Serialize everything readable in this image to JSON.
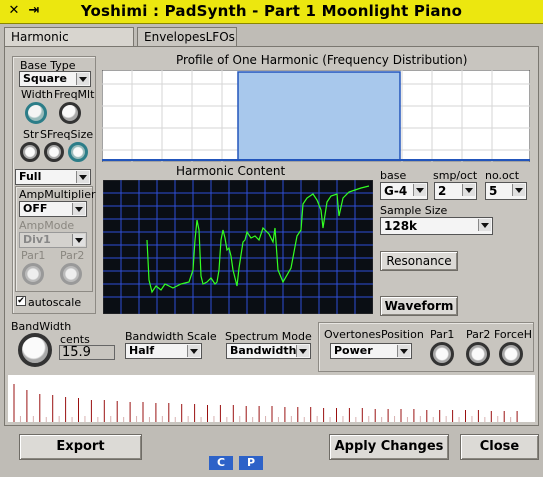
{
  "window": {
    "title": "Yoshimi : PadSynth - Part 1 Moonlight Piano",
    "pin_glyph": "✕",
    "close_glyph": "⇥"
  },
  "tabs": [
    {
      "label": "Harmonic Structure",
      "active": true
    },
    {
      "label": "EnvelopesLFOs",
      "active": false
    }
  ],
  "left_panel": {
    "base_type_label": "Base Type",
    "base_type_value": "Square",
    "width_label": "Width",
    "freqmlt_label": "FreqMlt",
    "str_label": "Str",
    "sfreqsize_label": "SFreqSize",
    "full_value": "Full",
    "ampmultiplier_label": "AmpMultiplier",
    "ampmultiplier_value": "OFF",
    "ampmode_label": "AmpMode",
    "ampmode_value": "Div1",
    "par1_label": "Par1",
    "par2_label": "Par2",
    "autoscale_label": "autoscale",
    "autoscale_checked": true
  },
  "profile": {
    "title": "Profile of One Harmonic (Frequency Distribution)"
  },
  "harmonic_content": {
    "title": "Harmonic Content"
  },
  "right_controls": {
    "base_label": "base",
    "base_value": "G-4",
    "smp_oct_label": "smp/oct",
    "smp_oct_value": "2",
    "no_oct_label": "no.oct",
    "no_oct_value": "5",
    "sample_size_label": "Sample Size",
    "sample_size_value": "128k",
    "resonance_label": "Resonance",
    "waveform_label": "Waveform"
  },
  "bottom": {
    "bandwidth_label": "BandWidth",
    "cents_label": "cents",
    "cents_value": "15.9",
    "bandwidth_scale_label": "Bandwidth Scale",
    "bandwidth_scale_value": "Half",
    "spectrum_mode_label": "Spectrum Mode",
    "spectrum_mode_value": "Bandwidth",
    "overtones_label": "OvertonesPosition",
    "overtones_value": "Power",
    "par1_label": "Par1",
    "par2_label": "Par2",
    "forceh_label": "ForceH"
  },
  "footer": {
    "export_label": "Export",
    "apply_label": "Apply Changes",
    "close_label": "Close",
    "c_label": "C",
    "p_label": "P"
  },
  "colors": {
    "titlebar": "#ece70f",
    "graph_bg": "#0a0e14",
    "graph_grid": "#2f4fd6",
    "graph_line": "#33ff22",
    "profile_fill": "#a8c8ec",
    "spectrum_line": "#9a1010",
    "cp_button": "#2d62c8"
  }
}
